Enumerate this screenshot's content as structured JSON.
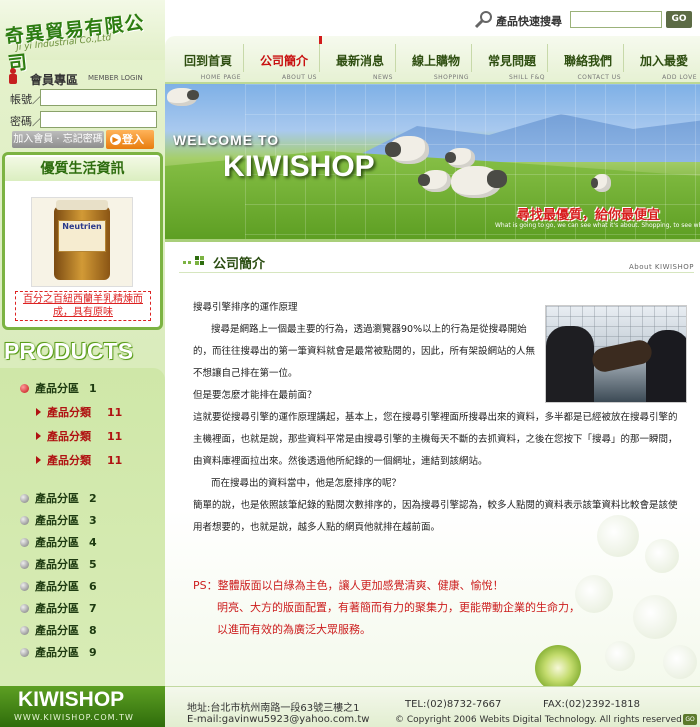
{
  "brand": {
    "name_cn": "奇異貿易有限公司",
    "name_en": "Ji yi Industrial Co.,Ltd"
  },
  "member": {
    "title": "會員專區",
    "subtitle": "MEMBER LOGIN",
    "account_label": "帳號／",
    "password_label": "密碼／",
    "join_label": "加入會員 · 忘記密碼",
    "login_label": "登入",
    "icon": "member-icon"
  },
  "promo": {
    "title": "優質生活資訊",
    "bottle_label": "Neutrien",
    "text": "百分之百紐西蘭羊乳精煉而成，具有原味"
  },
  "products": {
    "title": "PRODUCTS",
    "categories": [
      {
        "label": "產品分區",
        "num": "1"
      },
      {
        "label": "產品分區",
        "num": "2"
      },
      {
        "label": "產品分區",
        "num": "3"
      },
      {
        "label": "產品分區",
        "num": "4"
      },
      {
        "label": "產品分區",
        "num": "5"
      },
      {
        "label": "產品分區",
        "num": "6"
      },
      {
        "label": "產品分區",
        "num": "7"
      },
      {
        "label": "產品分區",
        "num": "8"
      },
      {
        "label": "產品分區",
        "num": "9"
      }
    ],
    "subcategories": [
      {
        "label": "產品分類",
        "num": "11"
      },
      {
        "label": "產品分類",
        "num": "11"
      },
      {
        "label": "產品分類",
        "num": "11"
      }
    ]
  },
  "footer_logo": {
    "brand": "KIWISHOP",
    "url": "WWW.KIWISHOP.COM.TW"
  },
  "search": {
    "label": "產品快速搜尋",
    "go": "GO",
    "icon": "search-icon"
  },
  "nav": [
    {
      "cn": "回到首頁",
      "en": "HOME PAGE"
    },
    {
      "cn": "公司簡介",
      "en": "ABOUT US"
    },
    {
      "cn": "最新消息",
      "en": "NEWS"
    },
    {
      "cn": "線上購物",
      "en": "SHOPPING"
    },
    {
      "cn": "常見問題",
      "en": "SHILL F&Q"
    },
    {
      "cn": "聯絡我們",
      "en": "CONTACT US"
    },
    {
      "cn": "加入最愛",
      "en": "ADD LOVE"
    }
  ],
  "banner": {
    "welcome": "WELCOME TO",
    "title": "KIWISHOP",
    "slogan": "尋找最優質，給你最便宜",
    "small_text": "What is going to go, we can see what it's about. Shopping, to see what ourselves. What lets us not lose sleep on it?"
  },
  "section": {
    "title": "公司簡介",
    "en": "About KIWISHOP"
  },
  "article": {
    "heading": "搜尋引擎排序的運作原理",
    "p1": "搜尋是網路上一個最主要的行為，透過瀏覽器90%以上的行為是從搜尋開始的，而往往搜尋出的第一筆資料就會是最常被點閱的，因此，所有架設網站的人無不想讓自己排在第一位。",
    "q1": "但是要怎麼才能排在最前面？",
    "p2": "這就要從搜尋引擎的運作原理講起，基本上，您在搜尋引擎裡面所搜尋出來的資料，多半都是已經被放在搜尋引擎的主機裡面，也就是說，那些資料平常是由搜尋引擎的主機每天不斷的去抓資料，之後在您按下「搜尋」的那一瞬間，由資料庫裡面拉出來。然後透過他所紀錄的一個網址，連結到該網站。",
    "q2": "而在搜尋出的資料當中，他是怎麼排序的呢？",
    "p3": "簡單的說，也是依照該筆紀錄的點閱次數排序的，因為搜尋引擎認為，較多人點閱的資料表示該筆資料比較會是該使用者想要的，也就是說，越多人點的網頁他就排在越前面。"
  },
  "ps": {
    "line1": "PS：整體版面以白綠為主色，讓人更加感覺清爽、健康、愉悅！",
    "line2": "明亮、大方的版面配置，有著簡而有力的聚集力，更能帶動企業的生命力，",
    "line3": "以進而有效的為廣泛大眾服務。"
  },
  "footer": {
    "address": "地址:台北市杭州南路一段63號三樓之1",
    "tel": "TEL:(02)8732-7667",
    "fax": "FAX:(02)2392-1818",
    "email": "E-mail:gavinwu5923@yahoo.com.tw",
    "copyright": "© Copyright 2006 Webits Digital Technology. All rights reserved",
    "top": "GO"
  },
  "colors": {
    "accent_green": "#5c9e1c",
    "active_red": "#c81010",
    "login_orange": "#e87d0e"
  }
}
